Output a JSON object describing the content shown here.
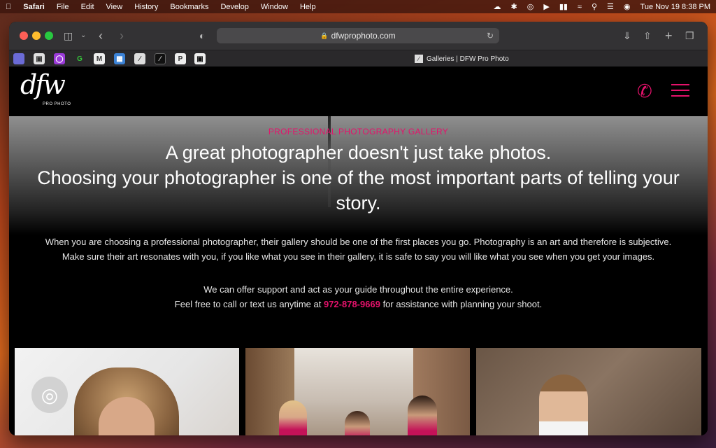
{
  "menubar": {
    "app_name": "Safari",
    "menus": [
      "File",
      "Edit",
      "View",
      "History",
      "Bookmarks",
      "Develop",
      "Window",
      "Help"
    ],
    "datetime": "Tue Nov 19  8:38 PM"
  },
  "browser": {
    "address": "dfwprophoto.com",
    "tab_title": "Galleries | DFW Pro Photo"
  },
  "site": {
    "logo_text": "dfw",
    "logo_sub": "PRO PHOTO",
    "eyebrow": "PROFESSIONAL PHOTOGRAPHY GALLERY",
    "headline_line1": "A great photographer doesn't just take photos.",
    "headline_line2": "Choosing your photographer is one of the most important parts of telling your story.",
    "para1_line1": "When you are choosing a professional photographer, their gallery should be one of the first places you go. Photography is an art and therefore is subjective.",
    "para1_line2": "Make sure their art resonates with you, if you like what you see in their gallery, it is safe to say you will like what you see when you get your images.",
    "para2_line1": "We can offer support and act as your guide throughout the entire experience.",
    "para2_prefix": "Feel free to call or text us anytime at",
    "phone": "972-878-9669",
    "para2_suffix": "for assistance with planning your shoot."
  },
  "colors": {
    "accent": "#e5126b"
  }
}
